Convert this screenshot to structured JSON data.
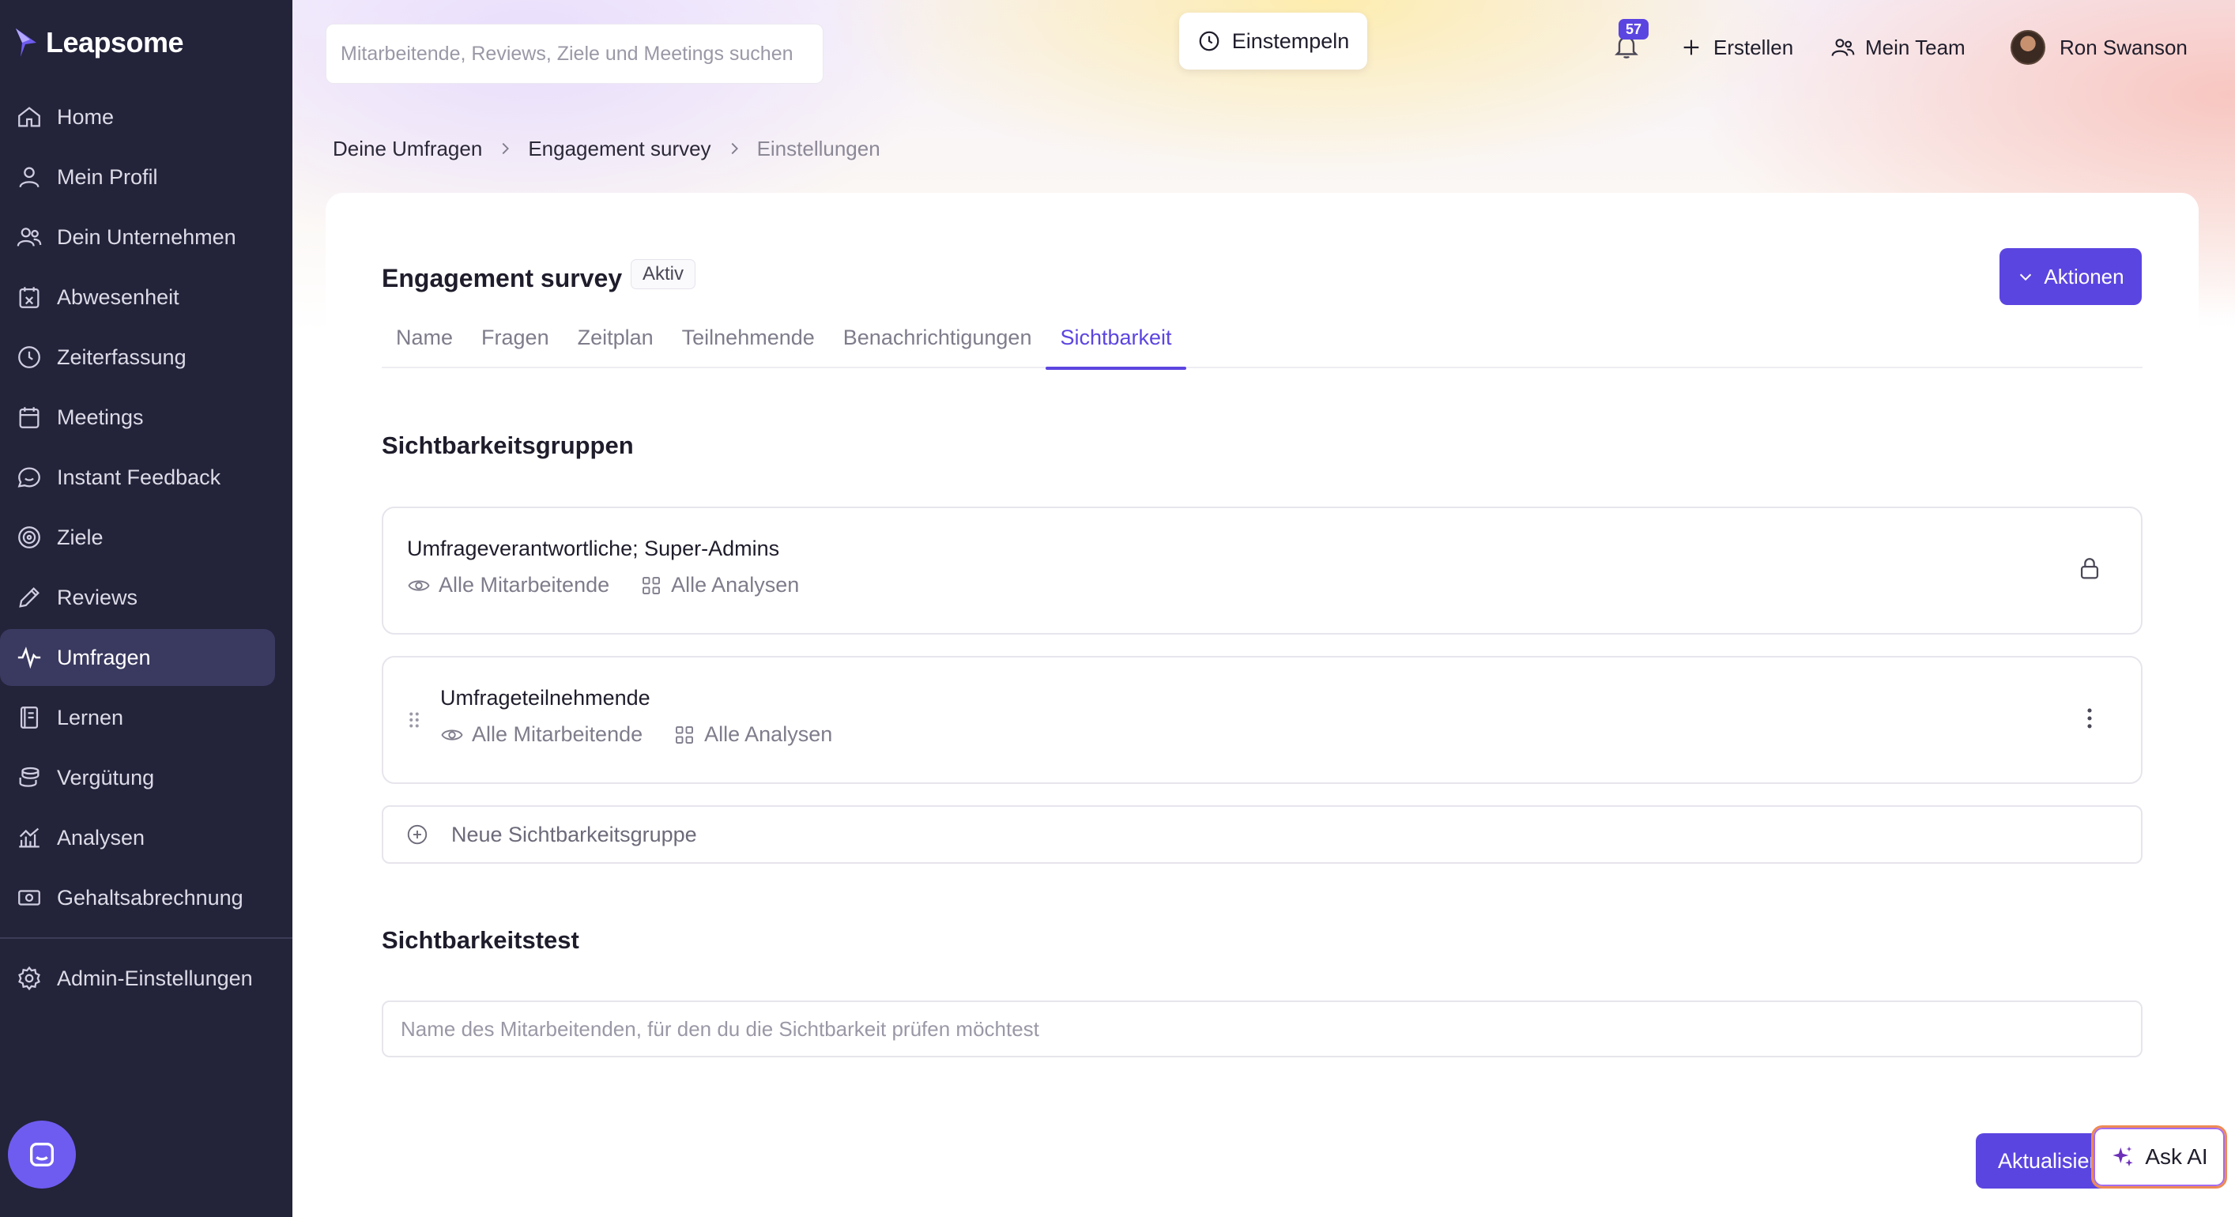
{
  "app": {
    "brand": "Leapsome"
  },
  "sidebar": {
    "items": [
      {
        "label": "Home",
        "icon": "home-icon"
      },
      {
        "label": "Mein Profil",
        "icon": "user-icon"
      },
      {
        "label": "Dein Unternehmen",
        "icon": "users-icon"
      },
      {
        "label": "Abwesenheit",
        "icon": "calendar-x-icon"
      },
      {
        "label": "Zeiterfassung",
        "icon": "clock-icon"
      },
      {
        "label": "Meetings",
        "icon": "calendar-icon"
      },
      {
        "label": "Instant Feedback",
        "icon": "chat-icon"
      },
      {
        "label": "Ziele",
        "icon": "target-icon"
      },
      {
        "label": "Reviews",
        "icon": "pencil-icon"
      },
      {
        "label": "Umfragen",
        "icon": "pulse-icon",
        "active": true
      },
      {
        "label": "Lernen",
        "icon": "book-icon"
      },
      {
        "label": "Vergütung",
        "icon": "coins-icon"
      },
      {
        "label": "Analysen",
        "icon": "chart-icon"
      },
      {
        "label": "Gehaltsabrechnung",
        "icon": "money-icon"
      }
    ],
    "admin": {
      "label": "Admin-Einstellungen",
      "icon": "gear-icon"
    }
  },
  "topbar": {
    "search_placeholder": "Mitarbeitende, Reviews, Ziele und Meetings suchen",
    "clock_in_label": "Einstempeln",
    "notifications_count": "57",
    "create_label": "Erstellen",
    "team_label": "Mein Team",
    "user_name": "Ron Swanson"
  },
  "breadcrumb": [
    "Deine Umfragen",
    "Engagement survey",
    "Einstellungen"
  ],
  "survey": {
    "title": "Engagement survey",
    "status": "Aktiv",
    "actions_label": "Aktionen",
    "tabs": [
      "Name",
      "Fragen",
      "Zeitplan",
      "Teilnehmende",
      "Benachrichtigungen",
      "Sichtbarkeit"
    ],
    "active_tab": "Sichtbarkeit"
  },
  "visibility_groups": {
    "heading": "Sichtbarkeitsgruppen",
    "groups": [
      {
        "name": "Umfrageverantwortliche; Super-Admins",
        "employees": "Alle Mitarbeitende",
        "analyses": "Alle Analysen",
        "locked": true
      },
      {
        "name": "Umfrageteilnehmende",
        "employees": "Alle Mitarbeitende",
        "analyses": "Alle Analysen",
        "locked": false
      }
    ],
    "new_group_label": "Neue Sichtbarkeitsgruppe"
  },
  "visibility_test": {
    "heading": "Sichtbarkeitstest",
    "placeholder": "Name des Mitarbeitenden, für den du die Sichtbarkeit prüfen möchtest"
  },
  "footer": {
    "update_label": "Aktualisieren",
    "ask_ai_label": "Ask AI"
  },
  "colors": {
    "accent": "#5b45e0",
    "sidebar": "#23233a",
    "sidebar_active": "#3a3960"
  }
}
